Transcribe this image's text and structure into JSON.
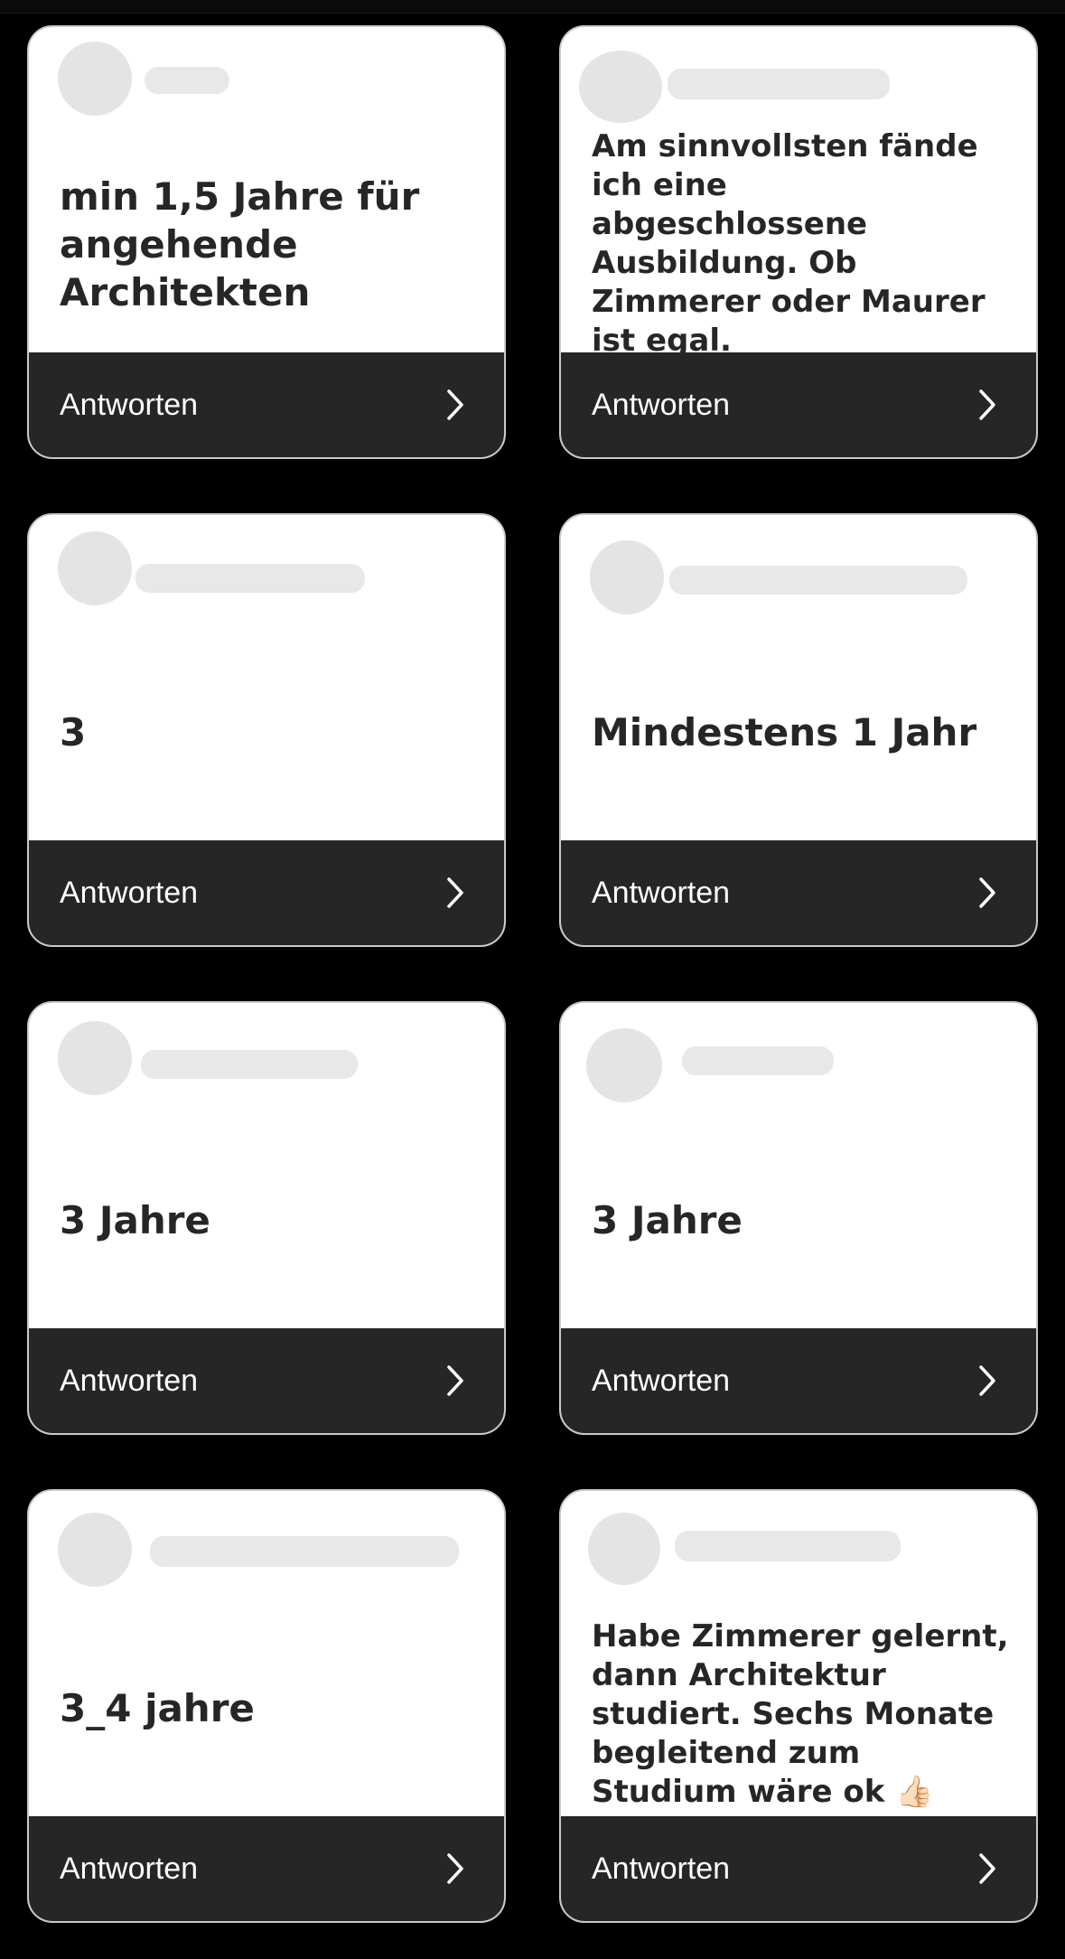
{
  "action_label": "Antworten",
  "cards": [
    {
      "text": "min 1,5 Jahre für angehende Architekten",
      "size": "large"
    },
    {
      "text": "Am sinnvollsten fände ich eine abgeschlossene Ausbildung. Ob Zimmerer oder Maurer ist egal.",
      "size": "small"
    },
    {
      "text": "3",
      "size": "large"
    },
    {
      "text": "Mindestens 1 Jahr",
      "size": "large"
    },
    {
      "text": "3 Jahre",
      "size": "large"
    },
    {
      "text": "3 Jahre",
      "size": "large"
    },
    {
      "text": "3_4 jahre",
      "size": "large"
    },
    {
      "text": "Habe Zimmerer gelernt, dann Architektur studiert. Sechs Monate begleitend zum Studium wäre ok 👍🏻",
      "size": "small"
    }
  ],
  "icons": {
    "chevron": "chevron-right-icon",
    "avatar": "avatar"
  },
  "colors": {
    "background": "#000000",
    "card": "#ffffff",
    "card_footer": "#262626",
    "text": "#262626",
    "footer_text": "#ffffff"
  }
}
